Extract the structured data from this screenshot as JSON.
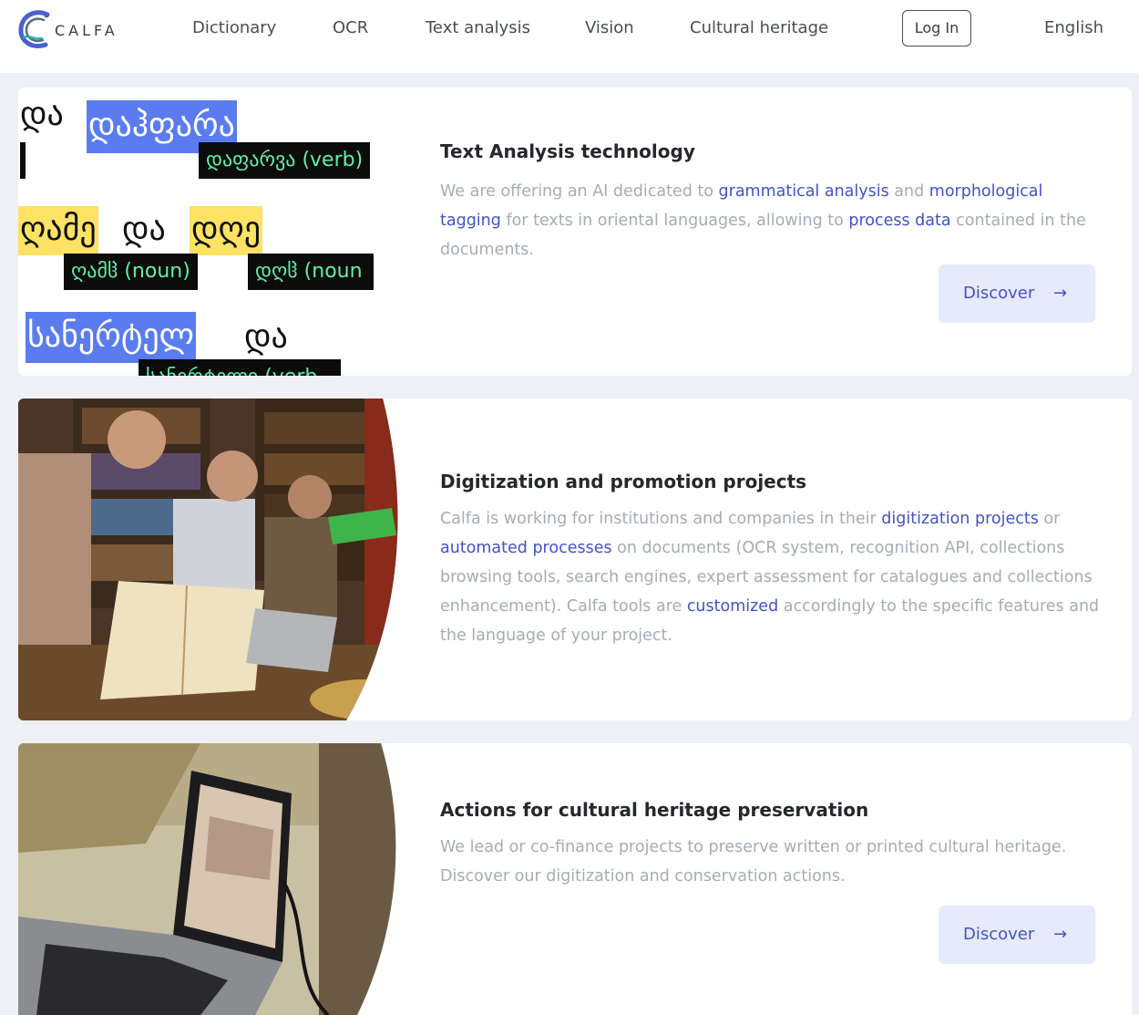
{
  "brand": {
    "name": "CALFA"
  },
  "nav": {
    "links": [
      "Dictionary",
      "OCR",
      "Text analysis",
      "Vision",
      "Cultural heritage"
    ],
    "login": "Log In",
    "language": "English"
  },
  "cards": [
    {
      "title": "Text Analysis technology",
      "text": [
        {
          "t": "We are offering an AI dedicated to "
        },
        {
          "t": "grammatical analysis",
          "hl": true
        },
        {
          "t": " and "
        },
        {
          "t": "morphological tagging",
          "hl": true
        },
        {
          "t": " for texts in oriental languages, allowing to "
        },
        {
          "t": "process data",
          "hl": true
        },
        {
          "t": " contained in the documents."
        }
      ],
      "button": "Discover",
      "button_icon": "arrow-right-icon",
      "media": {
        "words": [
          "და",
          "დაჰფარა",
          "ღამე",
          "და",
          "დღე",
          "სანერტელ",
          "და"
        ],
        "tags": [
          "დაფარვა (verb)",
          "ღამჱ (noun)",
          "დღჱ (noun",
          "სანერტელი (verb"
        ]
      }
    },
    {
      "title": "Digitization and promotion projects",
      "text": [
        {
          "t": "Calfa is working for institutions and companies in their "
        },
        {
          "t": "digitization projects",
          "hl": true
        },
        {
          "t": " or "
        },
        {
          "t": "automated processes",
          "hl": true
        },
        {
          "t": " on documents (OCR system, recognition API, collections browsing tools, search engines, expert assessment for catalogues and collections enhancement). Calfa tools are "
        },
        {
          "t": "customized",
          "hl": true
        },
        {
          "t": " accordingly to the specific features and the language of your project."
        }
      ]
    },
    {
      "title": "Actions for cultural heritage preservation",
      "text": [
        {
          "t": "We lead or co-finance projects to preserve written or printed cultural heritage. Discover our digitization and conservation actions."
        }
      ],
      "button": "Discover",
      "button_icon": "arrow-right-icon"
    }
  ],
  "colors": {
    "accent": "#4352c8",
    "button_bg": "#e7eafb",
    "muted_text": "#a7abb5",
    "tag_bg": "#0b0b0b",
    "tag_text": "#5ff0a8",
    "word_blue": "#5b7cf0",
    "word_yellow": "#fde263"
  }
}
